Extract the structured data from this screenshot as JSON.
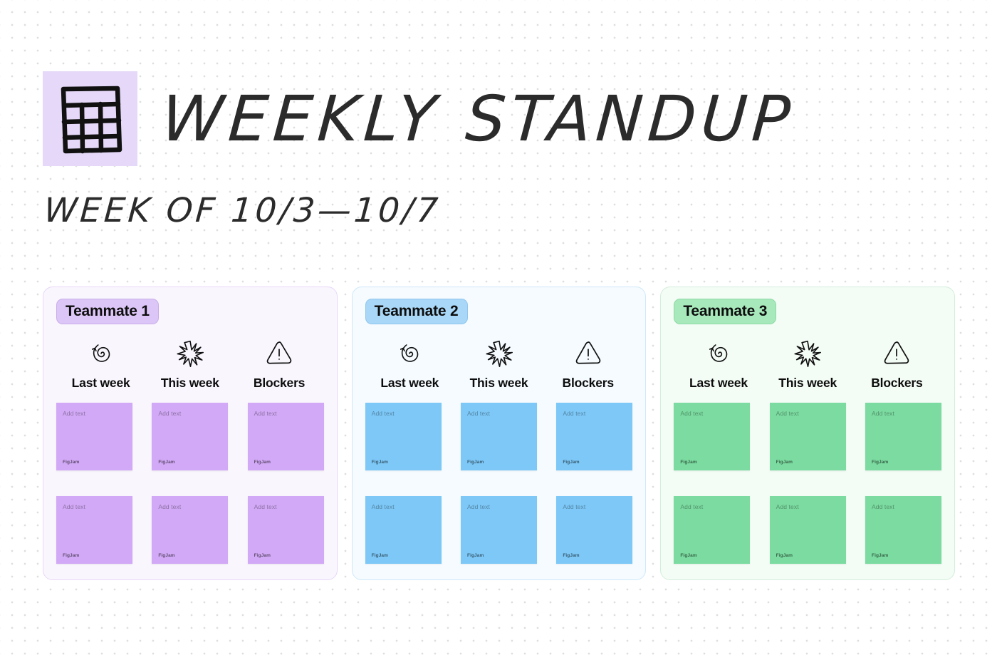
{
  "board": {
    "logo_icon": "table-grid-icon",
    "title": "WEEKLY STANDUP",
    "subtitle": "WEEK OF 10/3—10/7"
  },
  "colors": {
    "logo_tile": "#E5D8F8",
    "purple_note": "#D2A9F6",
    "blue_note": "#7DC8F7",
    "green_note": "#7BDBA0",
    "purple_card": "#FAF6FE",
    "blue_card": "#F5FBFF",
    "green_card": "#F3FCF5",
    "purple_badge": "#DCC6F7",
    "blue_badge": "#A9D7F7",
    "green_badge": "#A8E9BC",
    "canvas_dot": "#DEDEDE"
  },
  "note_defaults": {
    "placeholder": "Add text",
    "brand": "FigJam"
  },
  "categories": [
    {
      "label": "Last week",
      "icon": "spiral-arrow-icon"
    },
    {
      "label": "This week",
      "icon": "starburst-icon"
    },
    {
      "label": "Blockers",
      "icon": "warning-triangle-icon"
    }
  ],
  "columns": [
    {
      "badge": "Teammate 1",
      "theme": "purple",
      "notes": [
        {
          "placeholder": "Add text",
          "brand": "FigJam"
        },
        {
          "placeholder": "Add text",
          "brand": "FigJam"
        },
        {
          "placeholder": "Add text",
          "brand": "FigJam"
        },
        {
          "placeholder": "Add text",
          "brand": "FigJam"
        },
        {
          "placeholder": "Add text",
          "brand": "FigJam"
        },
        {
          "placeholder": "Add text",
          "brand": "FigJam"
        }
      ]
    },
    {
      "badge": "Teammate 2",
      "theme": "blue",
      "notes": [
        {
          "placeholder": "Add text",
          "brand": "FigJam"
        },
        {
          "placeholder": "Add text",
          "brand": "FigJam"
        },
        {
          "placeholder": "Add text",
          "brand": "FigJam"
        },
        {
          "placeholder": "Add text",
          "brand": "FigJam"
        },
        {
          "placeholder": "Add text",
          "brand": "FigJam"
        },
        {
          "placeholder": "Add text",
          "brand": "FigJam"
        }
      ]
    },
    {
      "badge": "Teammate 3",
      "theme": "green",
      "notes": [
        {
          "placeholder": "Add text",
          "brand": "FigJam"
        },
        {
          "placeholder": "Add text",
          "brand": "FigJam"
        },
        {
          "placeholder": "Add text",
          "brand": "FigJam"
        },
        {
          "placeholder": "Add text",
          "brand": "FigJam"
        },
        {
          "placeholder": "Add text",
          "brand": "FigJam"
        },
        {
          "placeholder": "Add text",
          "brand": "FigJam"
        }
      ]
    }
  ]
}
